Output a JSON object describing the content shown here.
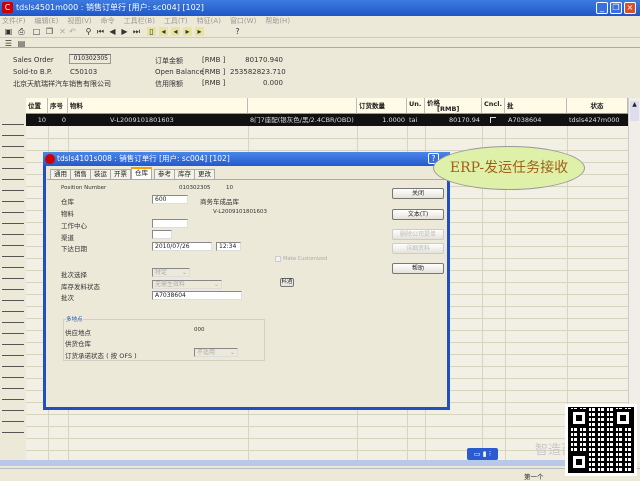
{
  "window": {
    "title": "tdsls4501m000 : 销售订单行 [用户: sc004] [102]"
  },
  "menu": [
    "文件(F)",
    "编辑(E)",
    "视图(V)",
    "命令",
    "工具栏(B)",
    "工具(T)",
    "特征(A)",
    "窗口(W)",
    "帮助(H)"
  ],
  "header": {
    "sales_order_label": "Sales Order",
    "sales_order": "010302305",
    "sold_to_label": "Sold-to B.P.",
    "sold_to": "C50103",
    "customer_name": "北京天航瑞祥汽车销售有限公司",
    "order_amount_label": "订单金额",
    "currency": "[RMB      ]",
    "order_amount": "80170.940",
    "open_balance_label": "Open Balance",
    "open_balance": "253582823.710",
    "credit_limit_label": "信用限额",
    "credit_limit": "0.000"
  },
  "grid": {
    "columns": [
      "位置",
      "序号",
      "物料",
      "",
      "订货数量",
      "Un.",
      "价格",
      "Cncl.",
      "批",
      "状态"
    ],
    "price_currency": "[RMB]",
    "rows": [
      {
        "position": "10",
        "seq": "0",
        "item": "V-L2009101801603",
        "description": "8门7座配(银灰色/黑/2.4CBR/OBD)",
        "qty": "1.0000",
        "unit": "tai",
        "price": "80170.94",
        "lot": "A7038604",
        "status": "tdsls4247m000"
      }
    ]
  },
  "dialog": {
    "title": "tdsls4101s008 : 销售订单行 [用户: sc004] [102]",
    "tabs": [
      "通用",
      "销售",
      "装运",
      "开票",
      "仓库",
      "参考",
      "库存",
      "更改"
    ],
    "active_tab": "仓库",
    "position_number_label": "Position Number",
    "order": "010302305",
    "position": "10",
    "warehouse_label": "仓库",
    "warehouse": "600",
    "warehouse_name": "商务车成品库",
    "item_label": "物料",
    "item": "V-L2009101801603",
    "work_center_label": "工作中心",
    "channel_label": "渠道",
    "release_date_label": "下达日期",
    "release_date": "2010/07/26",
    "release_time": "12:34",
    "make_customized": "Make Customized",
    "lot_selection_label": "批次选择",
    "lot_selection": "特定",
    "inventory_status_label": "库存发料状态",
    "inventory_status": "无需生效料",
    "lot_label": "批次",
    "lot": "A7038604",
    "lot_button": "料酒",
    "group_label": "多地点",
    "supply_site_label": "供应地点",
    "supply_site": "000",
    "supply_warehouse_label": "供货仓库",
    "ofs_status_label": "订货承诺状态 ( 按 OFS )",
    "ofs_status": "不适用",
    "buttons": {
      "close": "关闭",
      "text": "文本(T)",
      "remove": "删除公司提单",
      "details": "详细资料",
      "help": "帮助"
    }
  },
  "annotation": "ERP-发运任务接收",
  "status_bar": {
    "record": "第一个"
  },
  "watermark": "智造百家"
}
